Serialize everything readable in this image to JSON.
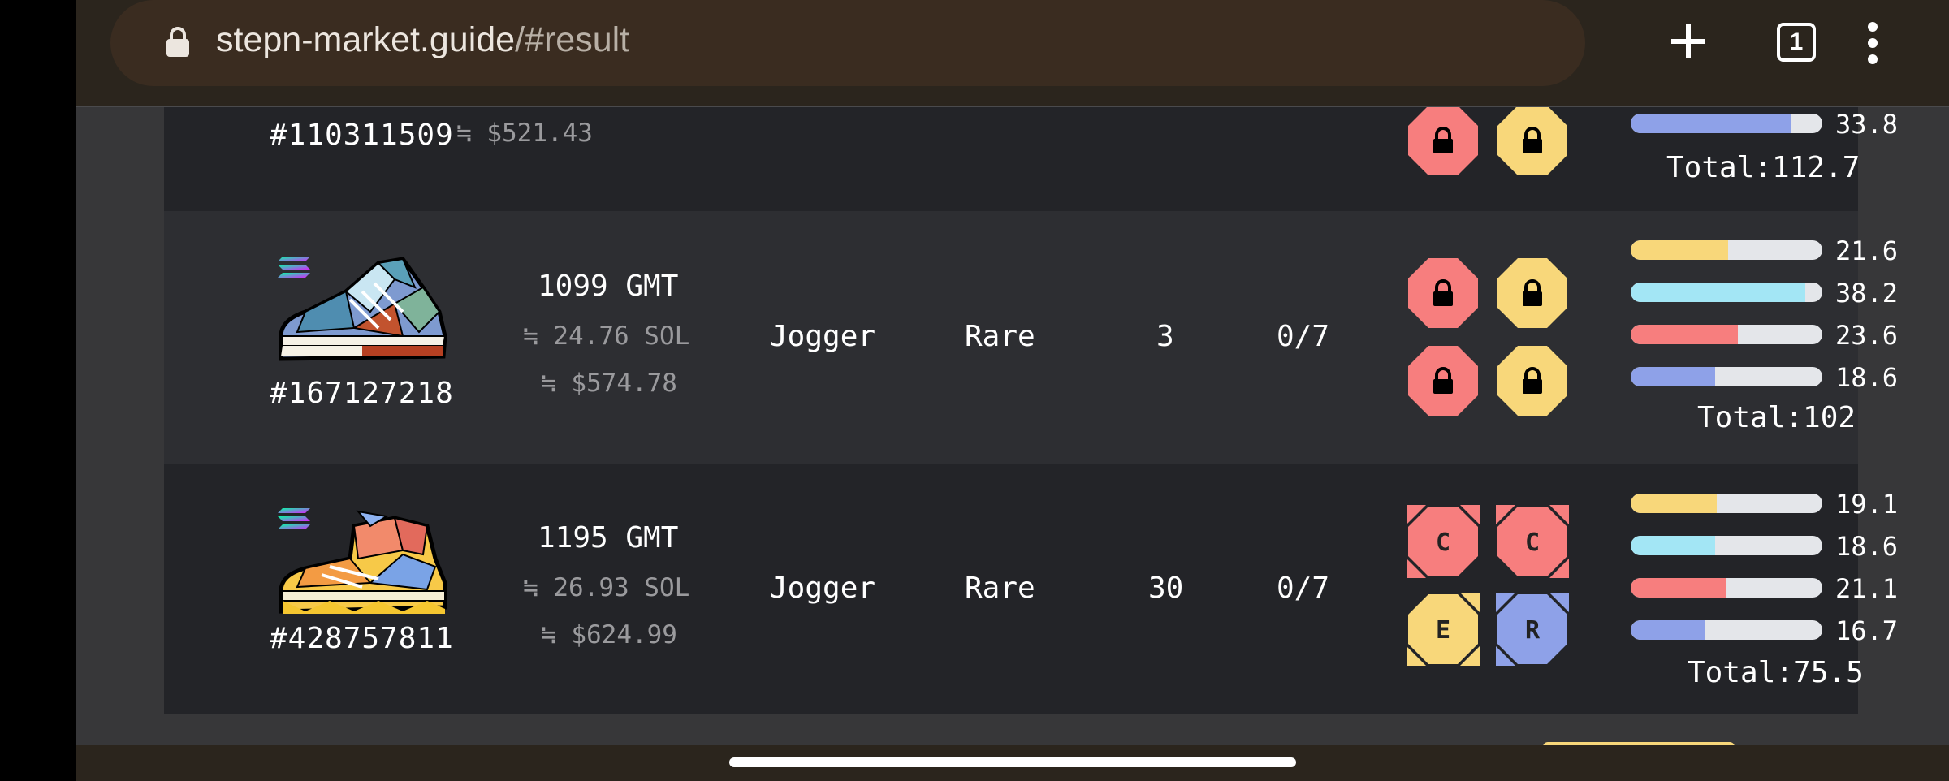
{
  "browser": {
    "url_domain": "stepn-market.guide",
    "url_path": "/#result",
    "tab_count": "1"
  },
  "colors": {
    "efficiency": "#f8d77a",
    "luck": "#a3e6f5",
    "comfort": "#f77e7e",
    "resilience": "#8ea1e8",
    "row_dark": "#232428",
    "row_light": "#2d2e32"
  },
  "rows": [
    {
      "id": "#110311509",
      "price_usd": "≒ $521.43",
      "sockets": [
        {
          "color": "comfort",
          "label": "lock-icon"
        },
        {
          "color": "efficiency",
          "label": "lock-icon"
        }
      ],
      "attributes": [
        {
          "type": "resilience",
          "value": "33.8",
          "fill": 0.84
        }
      ],
      "total": "Total:112.7"
    },
    {
      "id": "#167127218",
      "price_gmt": "1099 GMT",
      "price_sol": "≒ 24.76 SOL",
      "price_usd": "≒ $574.78",
      "type": "Jogger",
      "rarity": "Rare",
      "level": "3",
      "mint": "0/7",
      "sockets": [
        {
          "color": "comfort",
          "label": "lock-icon"
        },
        {
          "color": "efficiency",
          "label": "lock-icon"
        },
        {
          "color": "comfort",
          "label": "lock-icon"
        },
        {
          "color": "efficiency",
          "label": "lock-icon"
        }
      ],
      "attributes": [
        {
          "type": "efficiency",
          "value": "21.6",
          "fill": 0.51
        },
        {
          "type": "luck",
          "value": "38.2",
          "fill": 0.91
        },
        {
          "type": "comfort",
          "value": "23.6",
          "fill": 0.56
        },
        {
          "type": "resilience",
          "value": "18.6",
          "fill": 0.44
        }
      ],
      "total": "Total:102"
    },
    {
      "id": "#428757811",
      "price_gmt": "1195 GMT",
      "price_sol": "≒ 26.93 SOL",
      "price_usd": "≒ $624.99",
      "type": "Jogger",
      "rarity": "Rare",
      "level": "30",
      "mint": "0/7",
      "sockets": [
        {
          "color": "comfort",
          "label": "C"
        },
        {
          "color": "comfort",
          "label": "C"
        },
        {
          "color": "efficiency",
          "label": "E"
        },
        {
          "color": "resilience",
          "label": "R"
        }
      ],
      "attributes": [
        {
          "type": "efficiency",
          "value": "19.1",
          "fill": 0.45
        },
        {
          "type": "luck",
          "value": "18.6",
          "fill": 0.44
        },
        {
          "type": "comfort",
          "value": "21.1",
          "fill": 0.5
        },
        {
          "type": "resilience",
          "value": "16.7",
          "fill": 0.39
        }
      ],
      "total": "Total:75.5"
    }
  ]
}
